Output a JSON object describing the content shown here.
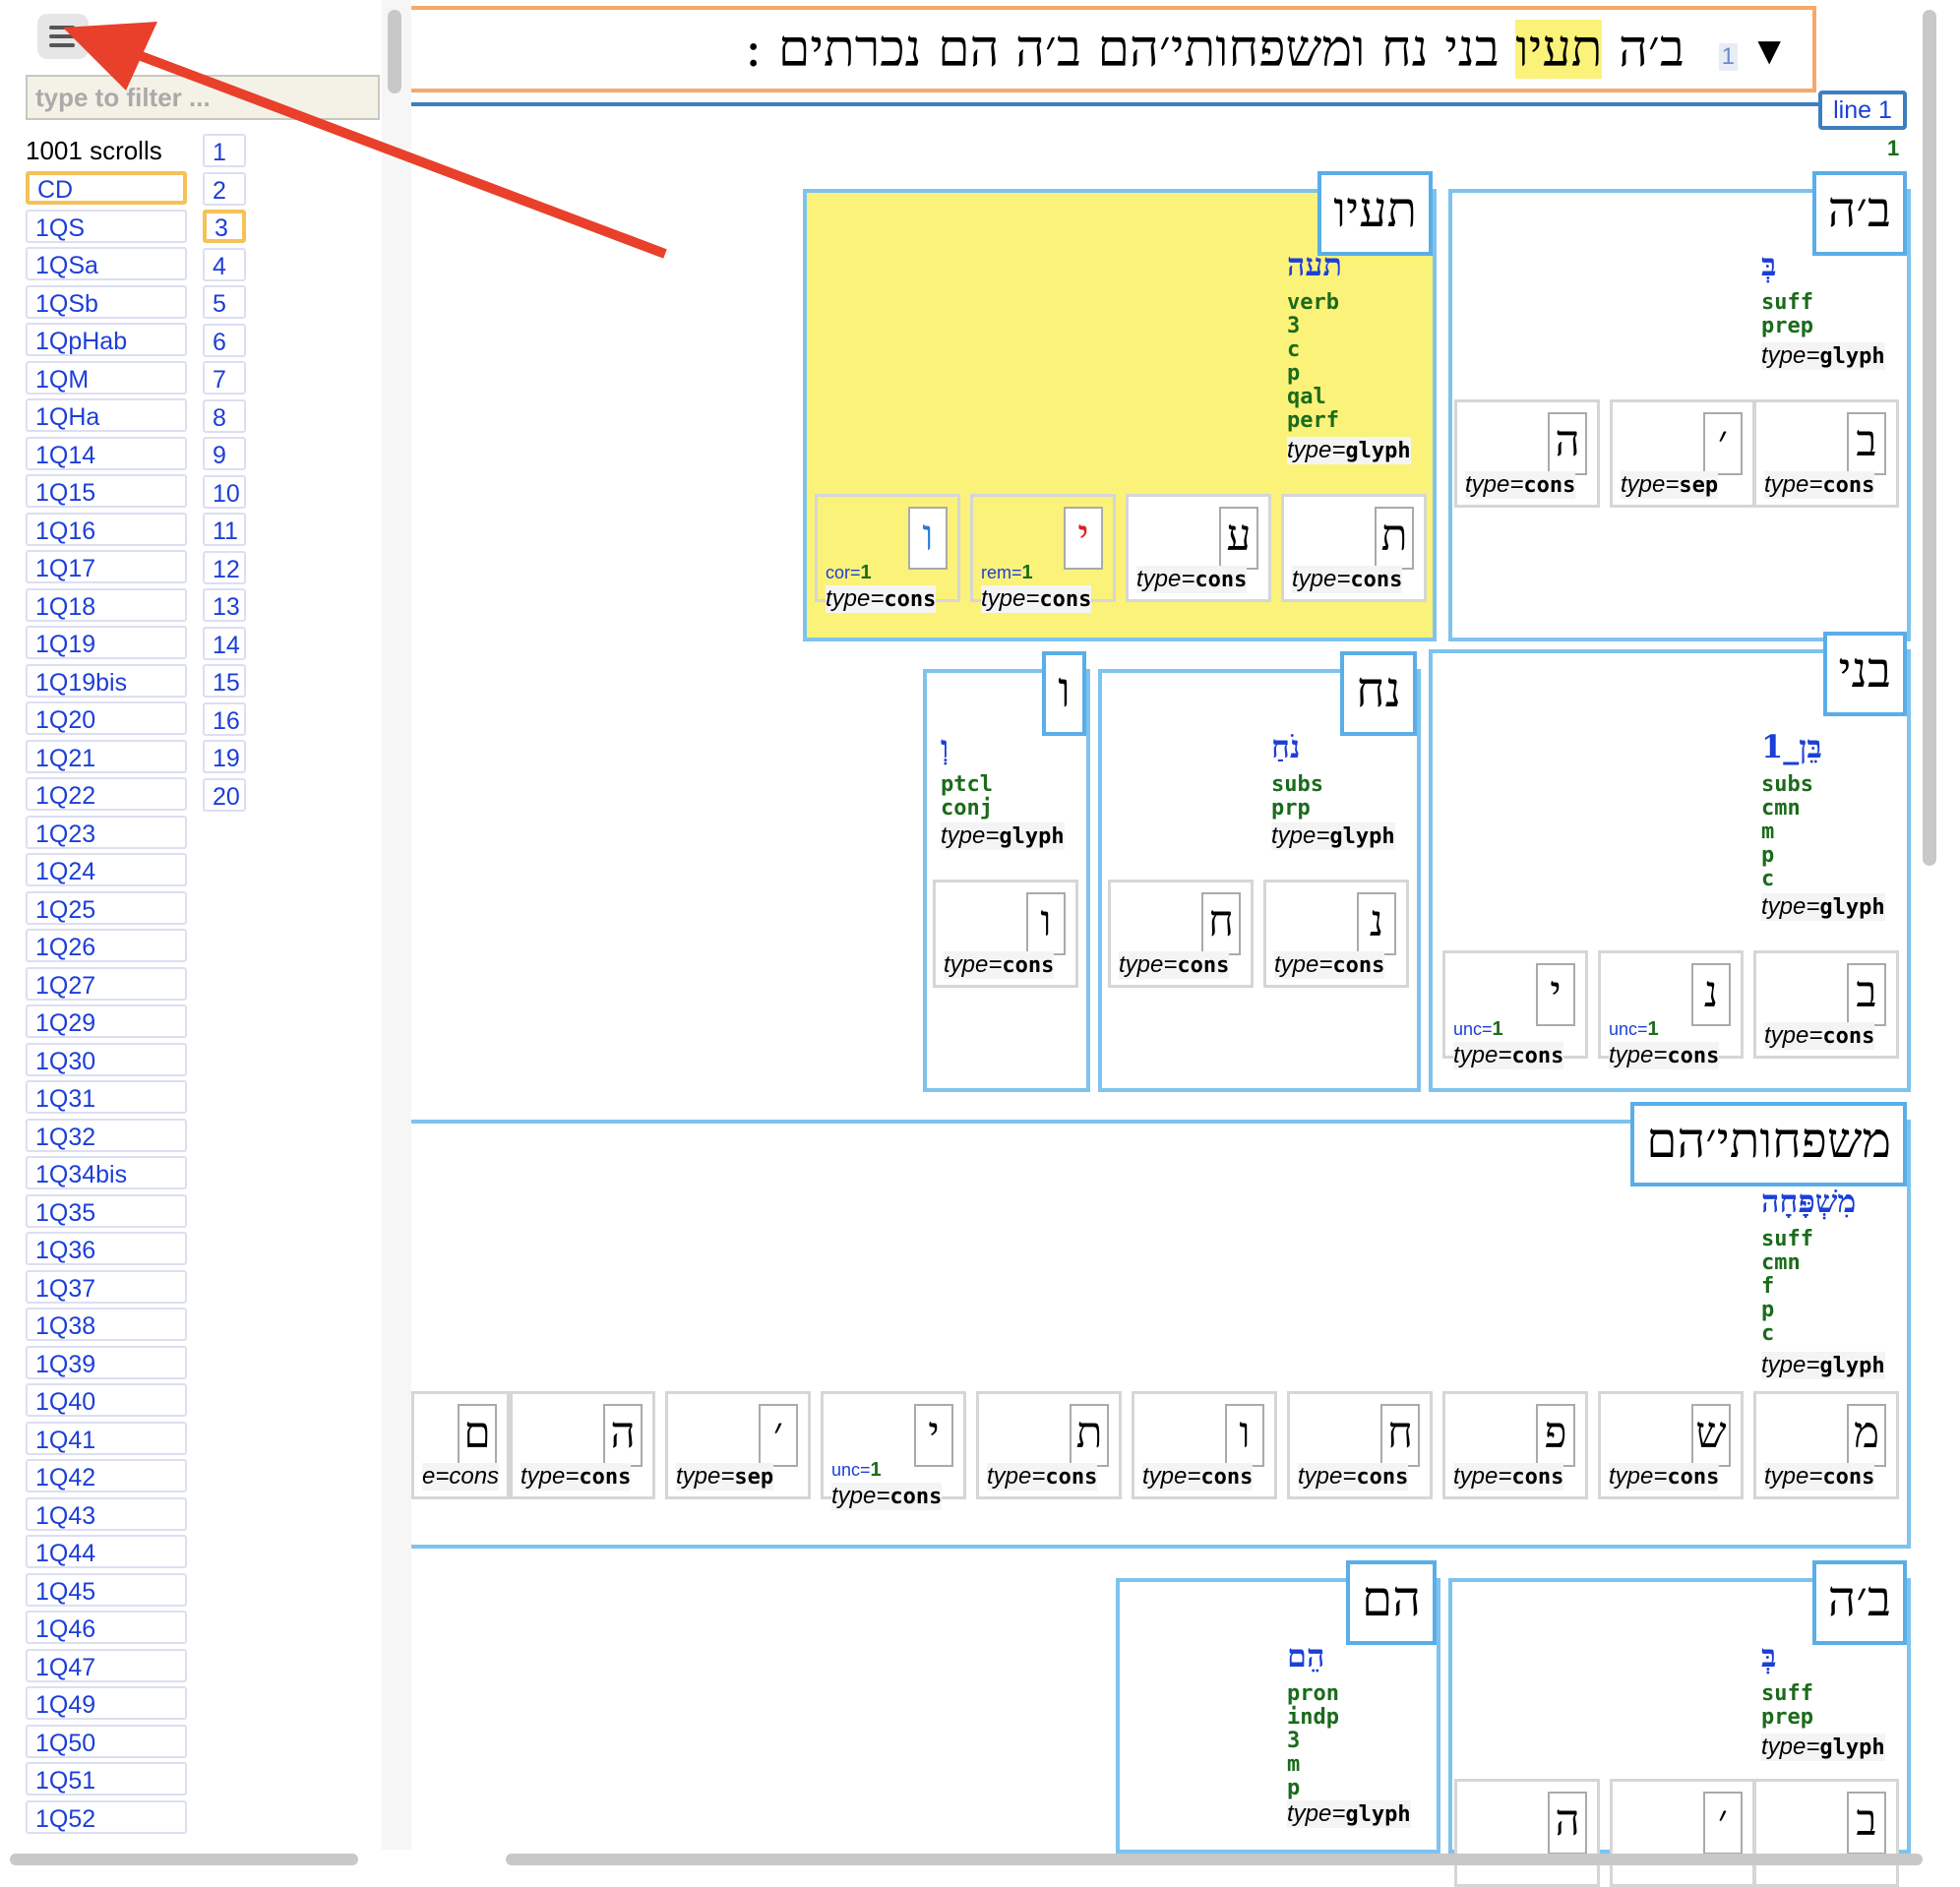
{
  "sidebar": {
    "filter_placeholder": "type to filter ...",
    "scroll_count": "1001 scrolls",
    "scrolls": [
      "CD",
      "1QS",
      "1QSa",
      "1QSb",
      "1QpHab",
      "1QM",
      "1QHa",
      "1Q14",
      "1Q15",
      "1Q16",
      "1Q17",
      "1Q18",
      "1Q19",
      "1Q19bis",
      "1Q20",
      "1Q21",
      "1Q22",
      "1Q23",
      "1Q24",
      "1Q25",
      "1Q26",
      "1Q27",
      "1Q29",
      "1Q30",
      "1Q31",
      "1Q32",
      "1Q34bis",
      "1Q35",
      "1Q36",
      "1Q37",
      "1Q38",
      "1Q39",
      "1Q40",
      "1Q41",
      "1Q42",
      "1Q43",
      "1Q44",
      "1Q45",
      "1Q46",
      "1Q47",
      "1Q49",
      "1Q50",
      "1Q51",
      "1Q52"
    ],
    "selected_scroll": "CD",
    "pages": [
      "1",
      "2",
      "3",
      "4",
      "5",
      "6",
      "7",
      "8",
      "9",
      "10",
      "11",
      "12",
      "13",
      "14",
      "15",
      "16",
      "19",
      "20"
    ],
    "selected_page": "3"
  },
  "header": {
    "text_before": "ב׳ה ",
    "text_highlight": "תעיו",
    "text_after": " בני נח ומשפחותי׳הם ב׳ה הם נכרתים  :",
    "line_number": "1",
    "triangle": "▼"
  },
  "line": {
    "badge": "line 1",
    "number": "1"
  },
  "words": {
    "bh1": {
      "label": "ב׳ה",
      "lex": "בְּ",
      "features": [
        "suff",
        "prep"
      ],
      "type_key": "type=",
      "type_val": "glyph",
      "signs": [
        {
          "g": "ב",
          "t": "cons"
        },
        {
          "g": "׳",
          "t": "sep"
        },
        {
          "g": "ה",
          "t": "cons"
        }
      ]
    },
    "taav": {
      "label": "תעיו",
      "lex": "תעה",
      "features": [
        "verb",
        "3",
        "c",
        "p",
        "qal",
        "perf"
      ],
      "type_key": "type=",
      "type_val": "glyph",
      "signs": [
        {
          "g": "ת",
          "t": "cons"
        },
        {
          "g": "ע",
          "t": "cons"
        },
        {
          "g": "י",
          "t": "cons",
          "fk": "rem=",
          "fv": "1"
        },
        {
          "g": "ו",
          "t": "cons",
          "fk": "cor=",
          "fv": "1"
        }
      ]
    },
    "bney": {
      "label": "בני",
      "lex": "בֵּן_1",
      "features": [
        "subs",
        "cmn",
        "m",
        "p",
        "c"
      ],
      "type_key": "type=",
      "type_val": "glyph",
      "signs": [
        {
          "g": "ב",
          "t": "cons"
        },
        {
          "g": "נ",
          "t": "cons",
          "fk": "unc=",
          "fv": "1"
        },
        {
          "g": "י",
          "t": "cons",
          "fk": "unc=",
          "fv": "1"
        }
      ]
    },
    "noah": {
      "label": "נח",
      "lex": "נֹחַ",
      "features": [
        "subs",
        "prp"
      ],
      "type_key": "type=",
      "type_val": "glyph",
      "signs": [
        {
          "g": "נ",
          "t": "cons"
        },
        {
          "g": "ח",
          "t": "cons"
        }
      ]
    },
    "vav": {
      "label": "ו",
      "lex": "וְ",
      "features": [
        "ptcl",
        "conj"
      ],
      "type_key": "type=",
      "type_val": "glyph",
      "signs": [
        {
          "g": "ו",
          "t": "cons"
        }
      ]
    },
    "mishp": {
      "label": "משפחותי׳הם",
      "lex": "מִשְׁפָּחָה",
      "features": [
        "suff",
        "cmn",
        "f",
        "p",
        "c"
      ],
      "type_key": "type=",
      "type_val": "glyph",
      "signs": [
        {
          "g": "מ",
          "t": "cons"
        },
        {
          "g": "ש",
          "t": "cons"
        },
        {
          "g": "פ",
          "t": "cons"
        },
        {
          "g": "ח",
          "t": "cons"
        },
        {
          "g": "ו",
          "t": "cons"
        },
        {
          "g": "ת",
          "t": "cons"
        },
        {
          "g": "י",
          "t": "cons",
          "fk": "unc=",
          "fv": "1"
        },
        {
          "g": "׳",
          "t": "sep"
        },
        {
          "g": "ה",
          "t": "cons"
        },
        {
          "g": "ם",
          "t": "e=cons"
        }
      ]
    },
    "bh2": {
      "label": "ב׳ה",
      "lex": "בְּ",
      "features": [
        "suff",
        "prep"
      ],
      "type_key": "type=",
      "type_val": "glyph",
      "signs": [
        {
          "g": "ב"
        },
        {
          "g": "׳"
        },
        {
          "g": "ה"
        }
      ]
    },
    "hem": {
      "label": "הם",
      "lex": "הֵם",
      "features": [
        "pron",
        "indp",
        "3",
        "m",
        "p"
      ],
      "type_key": "type=",
      "type_val": "glyph"
    }
  },
  "colors": {
    "accent": "#5aaee8",
    "highlight": "#fbf27a",
    "link": "#1c3fd6",
    "feature": "#1a6b1a",
    "selected": "#f5c25a",
    "annotation_arrow": "#e8402a"
  },
  "icons": {
    "menu": "list-icon",
    "collapse": "triangle-down-icon"
  }
}
